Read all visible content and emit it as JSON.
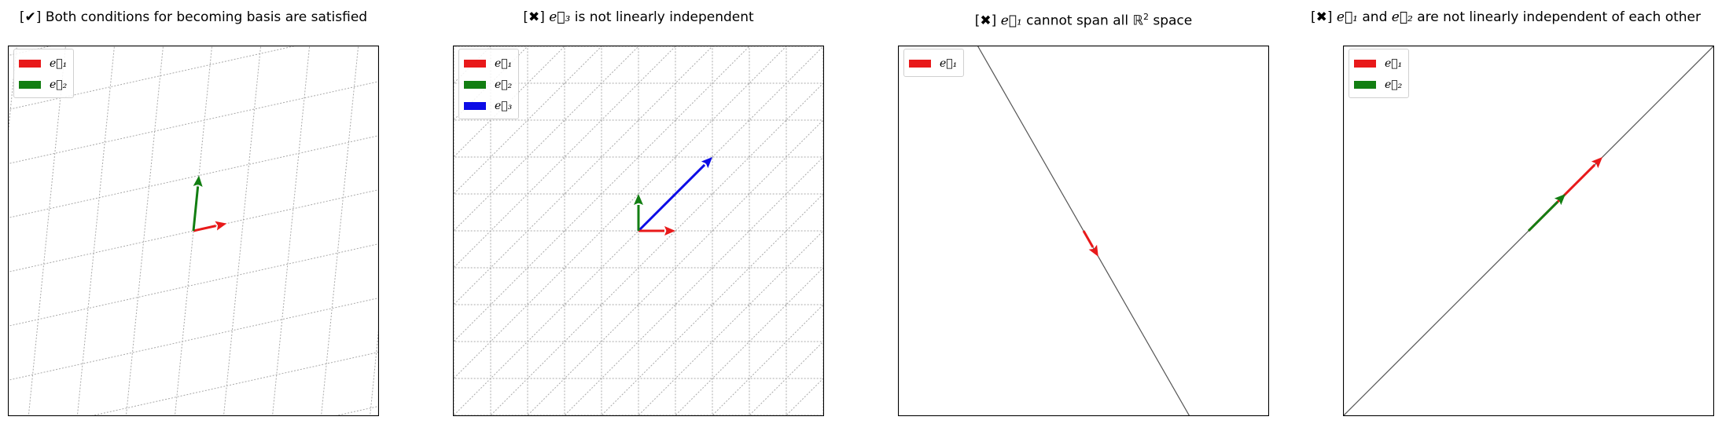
{
  "colors": {
    "e1": "#e8191a",
    "e2": "#127e12",
    "e3": "#0c0ce6",
    "grid": "#a9a9a9",
    "span": "#555555"
  },
  "panels": [
    {
      "title": {
        "mark": "[✔]",
        "text": "Both conditions for becoming basis are satisfied"
      },
      "legend": [
        "e⃗₁",
        "e⃗₂"
      ],
      "vectors": {
        "e1": [
          0.9,
          0.2
        ],
        "e2": [
          0.15,
          1.5
        ]
      }
    },
    {
      "title": {
        "mark": "[✖]",
        "pre": "",
        "vec": "e⃗₃",
        "post": " is not linearly independent"
      },
      "legend": [
        "e⃗₁",
        "e⃗₂",
        "e⃗₃"
      ],
      "vectors": {
        "e1": [
          1,
          0
        ],
        "e2": [
          0,
          1
        ],
        "e3": [
          2,
          2
        ]
      }
    },
    {
      "title": {
        "mark": "[✖]",
        "vec": "e⃗₁",
        "post1": " cannot span all ",
        "field": "ℝ",
        "sup": "2",
        "post2": " space"
      },
      "legend": [
        "e⃗₁"
      ],
      "vectors": {
        "e1": [
          0.4,
          -0.7
        ]
      }
    },
    {
      "title": {
        "mark": "[✖]",
        "vec1": "e⃗₁",
        "mid": " and ",
        "vec2": "e⃗₂",
        "post": " are not linearly independent of each other"
      },
      "legend": [
        "e⃗₁",
        "e⃗₂"
      ],
      "vectors": {
        "e1": [
          2,
          2
        ],
        "e2": [
          1,
          1
        ]
      }
    }
  ]
}
